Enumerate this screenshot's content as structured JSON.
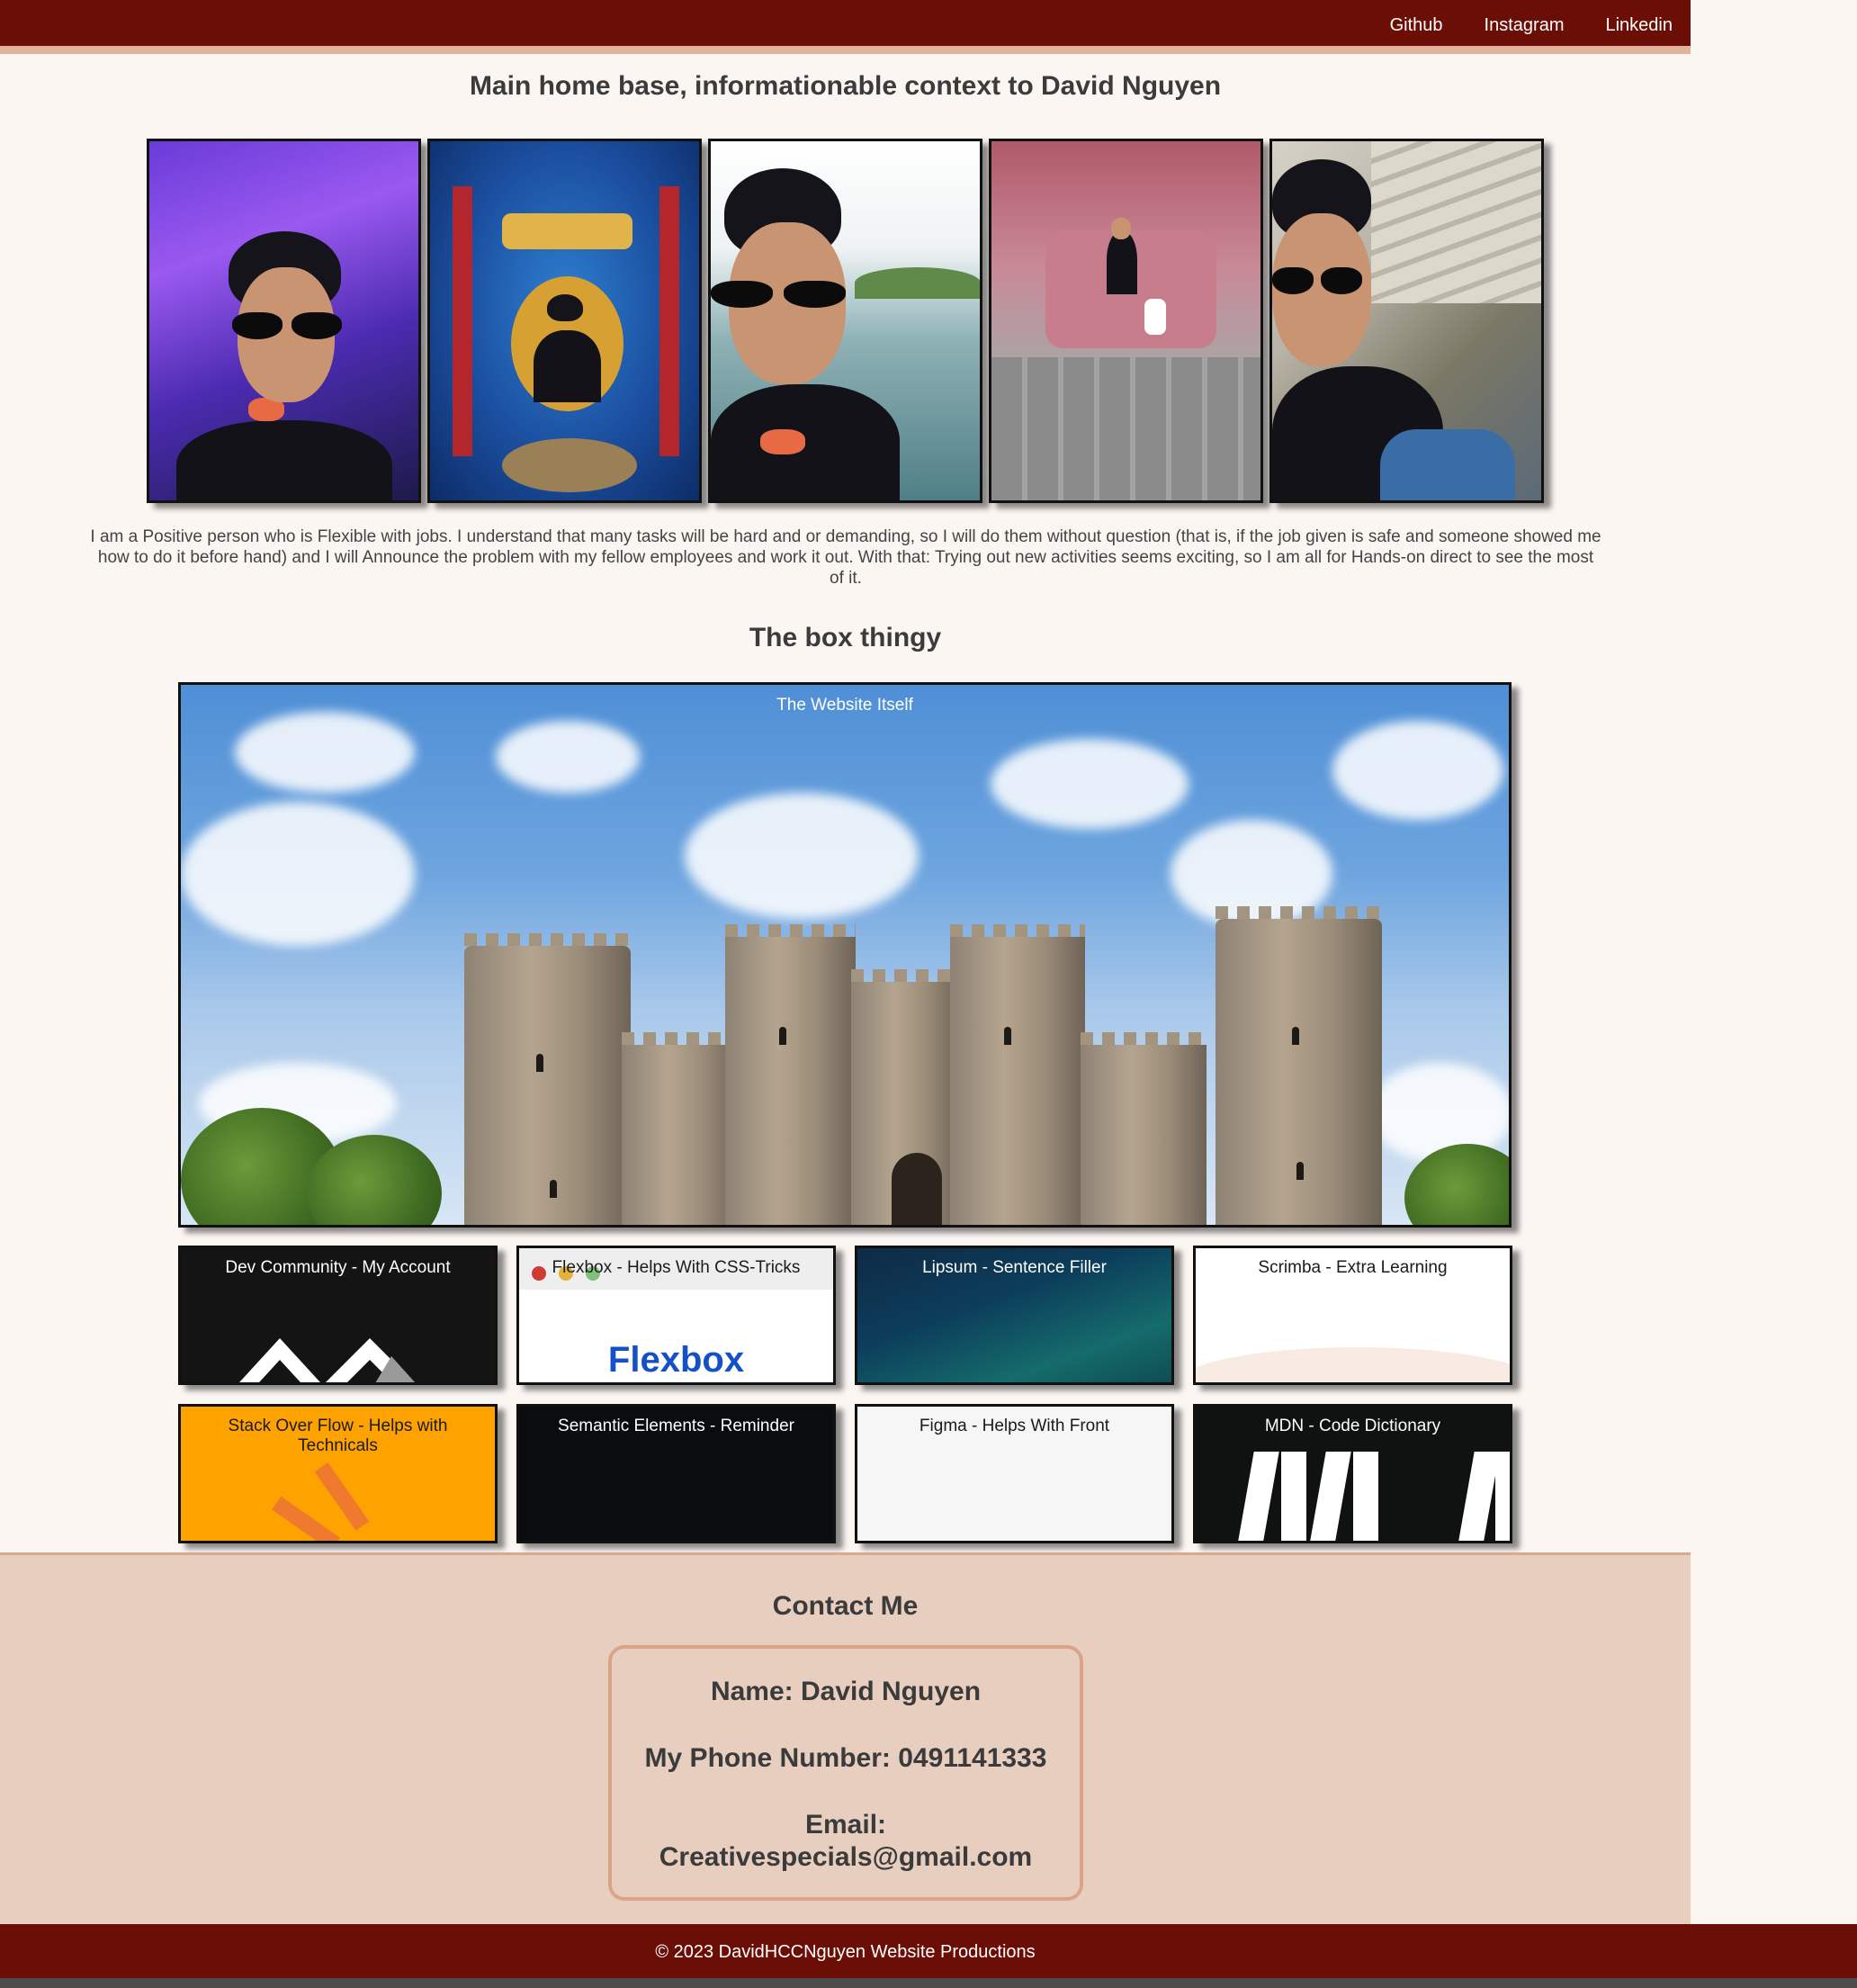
{
  "nav": {
    "links": [
      "Github",
      "Instagram",
      "Linkedin"
    ]
  },
  "header": {
    "title": "Main home base, informationable context to David Nguyen"
  },
  "about": {
    "text": "I am a Positive person who is Flexible with jobs. I understand that many tasks will be hard and or demanding, so I will do them without question (that is, if the job given is safe and someone showed me how to do it before hand) and I will Announce the problem with my fellow employees and work it out. With that: Trying out new activities seems exciting, so I am all for Hands-on direct to see the most of it."
  },
  "box_section": {
    "title": "The box thingy",
    "hero_caption": "The Website Itself",
    "cards": [
      "Dev Community - My Account",
      "Flexbox - Helps With CSS-Tricks",
      "Lipsum - Sentence Filler",
      "Scrimba - Extra Learning",
      "Stack Over Flow - Helps with Technicals",
      "Semantic Elements - Reminder",
      "Figma - Helps With Front",
      "MDN - Code Dictionary"
    ],
    "flexbox_logo_text": "Flexbox"
  },
  "contact": {
    "title": "Contact Me",
    "name": "Name: David Nguyen",
    "phone": "My Phone Number: 0491141333",
    "email_label": "Email:",
    "email": "Creativespecials@gmail.com"
  },
  "footer": {
    "text": "© 2023 DavidHCCNguyen Website Productions"
  },
  "colors": {
    "nav_bg": "#6b0f06",
    "accent_border": "#e2b39b",
    "page_bg": "#fcf6f3",
    "contact_bg": "#e8cebf",
    "stackoverflow_card": "#fea200"
  }
}
